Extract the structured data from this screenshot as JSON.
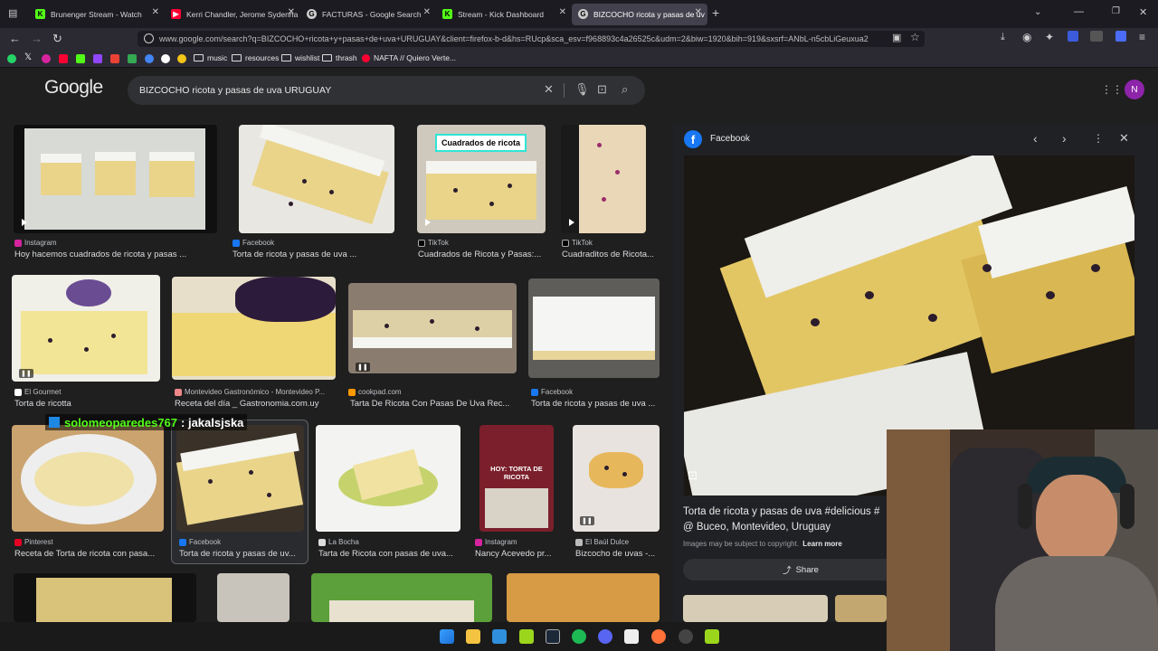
{
  "tabs": [
    {
      "title": "Brunenger Stream - Watch",
      "icon": "kick-icon",
      "color": "#53fc18"
    },
    {
      "title": "Kerri Chandler, Jerome Sydenha",
      "icon": "youtube-icon",
      "color": "#ff0033"
    },
    {
      "title": "FACTURAS - Google Search",
      "icon": "google-icon",
      "color": "#cccccc"
    },
    {
      "title": "Stream - Kick Dashboard",
      "icon": "kick-icon",
      "color": "#53fc18"
    },
    {
      "title": "BIZCOCHO ricota y pasas de uv",
      "icon": "google-icon",
      "color": "#cccccc"
    }
  ],
  "url": "www.google.com/search?q=BIZCOCHO+ricota+y+pasas+de+uva+URUGUAY&client=firefox-b-d&hs=RUcp&sca_esv=f968893c4a26525c&udm=2&biw=1920&bih=919&sxsrf=ANbL-n5cbLiGeuxua2",
  "bookmarks": {
    "folders": [
      "music",
      "resources",
      "wishlist",
      "thrash"
    ],
    "nafta": "NAFTA // Quiero Verte..."
  },
  "google": {
    "logo": "Google",
    "query": "BIZCOCHO ricota y pasas de uva URUGUAY",
    "avatar": "N"
  },
  "results": [
    {
      "source": "Instagram",
      "caption": "Hoy hacemos cuadrados de ricota y pasas ..."
    },
    {
      "source": "Facebook",
      "caption": "Torta de ricota y pasas de uva ..."
    },
    {
      "source": "TikTok",
      "caption": "Cuadrados de Ricota y Pasas:...",
      "overlay": "Cuadrados de ricota"
    },
    {
      "source": "TikTok",
      "caption": "Cuadraditos de Ricota..."
    },
    {
      "source": "El Gourmet",
      "caption": "Torta de ricotta"
    },
    {
      "source": "Montevideo Gastronómico - Montevideo P...",
      "caption": "Receta del día _ Gastronomia.com.uy"
    },
    {
      "source": "cookpad.com",
      "caption": "Tarta De Ricota Con Pasas De Uva Rec..."
    },
    {
      "source": "Facebook",
      "caption": "Torta de ricota y pasas de uva ..."
    },
    {
      "source": "Pinterest",
      "caption": "Receta de Torta de ricota con pasa..."
    },
    {
      "source": "Facebook",
      "caption": "Torta de ricota y pasas de uv..."
    },
    {
      "source": "La Bocha",
      "caption": "Tarta de Ricota con pasas de uva..."
    },
    {
      "source": "Instagram",
      "caption": "Nancy Acevedo pr...",
      "overlay": "HOY: TORTA DE RICOTA"
    },
    {
      "source": "El Baúl Dulce",
      "caption": "Bizcocho de uvas -..."
    }
  ],
  "panel": {
    "source": "Facebook",
    "title": "Torta de ricota y pasas de uva #delicious #",
    "location": "@ Buceo, Montevideo, Uruguay",
    "copyright": "Images may be subject to copyright.",
    "learn_more": "Learn more",
    "share": "Share"
  },
  "overlay_user": {
    "name": "solomeoparedes767",
    "message": ": jakalsjska"
  },
  "colors": {
    "accent_blue": "#8ab4f8",
    "facebook": "#1877f2",
    "page_bg": "#1f1f1f"
  }
}
